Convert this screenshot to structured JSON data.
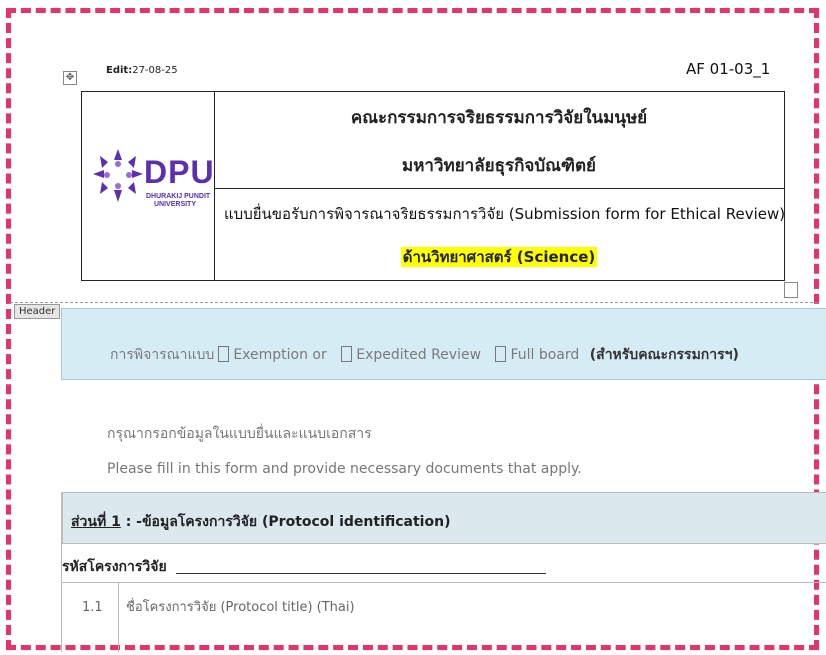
{
  "edit_label_prefix": "Edit:",
  "edit_label_date": "27-08-25",
  "form_code": "AF 01-03_1",
  "committee_name_th": "คณะกรรมการจริยธรรมการวิจัยในมนุษย์",
  "university_name_th": "มหาวิทยาลัยธุรกิจบัณฑิตย์",
  "form_title": "แบบยื่นขอรับการพิจารณาจริยธรรมการวิจัย (Submission form for Ethical Review)",
  "form_category": "ด้านวิทยาศาสตร์ (Science)",
  "logo": {
    "text": "DPU",
    "sub_line1": "DHURAKIJ PUNDIT",
    "sub_line2": "UNIVERSITY",
    "color": "#5b2fb0"
  },
  "header_tab_label": "Header",
  "review": {
    "prefix": "การพิจารณาแบบ",
    "option1": "Exemption or",
    "option2": "Expedited Review",
    "option3": "Full board",
    "note": "(สำหรับคณะกรรมการฯ)"
  },
  "instructions_th": "กรุณากรอกข้อมูลในแบบยื่นและแนบเอกสาร",
  "instructions_en": "Please fill in this form and provide necessary documents that apply.",
  "section1": {
    "label": "ส่วนที่ 1",
    "title": ": -ข้อมูลโครงการวิจัย (Protocol identification)"
  },
  "protocol_code_label": "รหัสโครงการวิจัย",
  "item_1_1": {
    "number": "1.1",
    "label": "ชื่อโครงการวิจัย (Protocol title) (Thai)"
  },
  "colors": {
    "frame_border": "#e8326b",
    "review_bg": "#d6ecf5",
    "highlight": "#ffff00",
    "section_bg": "#dbe9ef"
  }
}
